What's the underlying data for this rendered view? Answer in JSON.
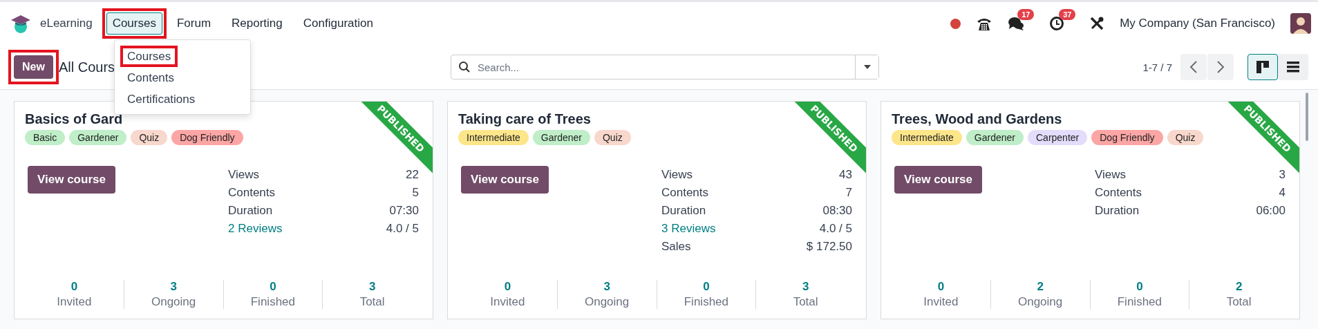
{
  "navbar": {
    "app_name": "eLearning",
    "menus": [
      {
        "label": "Courses",
        "selected": true,
        "highlighted": true
      },
      {
        "label": "Forum",
        "selected": false,
        "highlighted": false
      },
      {
        "label": "Reporting",
        "selected": false,
        "highlighted": false
      },
      {
        "label": "Configuration",
        "selected": false,
        "highlighted": false
      }
    ],
    "dropdown": [
      {
        "label": "Courses",
        "highlighted": true
      },
      {
        "label": "Contents",
        "highlighted": false
      },
      {
        "label": "Certifications",
        "highlighted": false
      }
    ],
    "messages_badge": "17",
    "activities_badge": "37",
    "company": "My Company (San Francisco)"
  },
  "control_panel": {
    "new_button": {
      "label": "New",
      "highlighted": true
    },
    "title": "All Cours",
    "search": {
      "placeholder": "Search..."
    },
    "pager": "1-7 / 7",
    "views": [
      {
        "kind": "kanban",
        "selected": true
      },
      {
        "kind": "list",
        "selected": false
      }
    ]
  },
  "cards": [
    {
      "title": "Basics of Gard",
      "ribbon": "PUBLISHED",
      "tags": [
        {
          "label": "Basic",
          "color": "#bfeec8"
        },
        {
          "label": "Gardener",
          "color": "#bfeec8"
        },
        {
          "label": "Quiz",
          "color": "#f8d7cc"
        },
        {
          "label": "Dog Friendly",
          "color": "#fca5a5"
        }
      ],
      "button": "View course",
      "stats": [
        {
          "kind": "plain",
          "label": "Views",
          "value": "22"
        },
        {
          "kind": "plain",
          "label": "Contents",
          "value": "5"
        },
        {
          "kind": "plain",
          "label": "Duration",
          "value": "07:30"
        },
        {
          "kind": "link",
          "label": "2 Reviews",
          "value": "4.0 / 5"
        }
      ],
      "counts": [
        {
          "value": "0",
          "label": "Invited"
        },
        {
          "value": "3",
          "label": "Ongoing"
        },
        {
          "value": "0",
          "label": "Finished"
        },
        {
          "value": "3",
          "label": "Total"
        }
      ]
    },
    {
      "title": "Taking care of Trees",
      "ribbon": "PUBLISHED",
      "tags": [
        {
          "label": "Intermediate",
          "color": "#fde68a"
        },
        {
          "label": "Gardener",
          "color": "#bfeec8"
        },
        {
          "label": "Quiz",
          "color": "#f8d7cc"
        }
      ],
      "button": "View course",
      "stats": [
        {
          "kind": "plain",
          "label": "Views",
          "value": "43"
        },
        {
          "kind": "plain",
          "label": "Contents",
          "value": "7"
        },
        {
          "kind": "plain",
          "label": "Duration",
          "value": "08:30"
        },
        {
          "kind": "link",
          "label": "3 Reviews",
          "value": "4.0 / 5"
        },
        {
          "kind": "plain",
          "label": "Sales",
          "value": "$ 172.50"
        }
      ],
      "counts": [
        {
          "value": "0",
          "label": "Invited"
        },
        {
          "value": "3",
          "label": "Ongoing"
        },
        {
          "value": "0",
          "label": "Finished"
        },
        {
          "value": "3",
          "label": "Total"
        }
      ]
    },
    {
      "title": "Trees, Wood and Gardens",
      "ribbon": "PUBLISHED",
      "tags": [
        {
          "label": "Intermediate",
          "color": "#fde68a"
        },
        {
          "label": "Gardener",
          "color": "#bfeec8"
        },
        {
          "label": "Carpenter",
          "color": "#e4dcfb"
        },
        {
          "label": "Dog Friendly",
          "color": "#fca5a5"
        },
        {
          "label": "Quiz",
          "color": "#f8d7cc"
        }
      ],
      "button": "View course",
      "stats": [
        {
          "kind": "plain",
          "label": "Views",
          "value": "3"
        },
        {
          "kind": "plain",
          "label": "Contents",
          "value": "4"
        },
        {
          "kind": "plain",
          "label": "Duration",
          "value": "06:00"
        }
      ],
      "counts": [
        {
          "value": "0",
          "label": "Invited"
        },
        {
          "value": "2",
          "label": "Ongoing"
        },
        {
          "value": "0",
          "label": "Finished"
        },
        {
          "value": "2",
          "label": "Total"
        }
      ]
    }
  ]
}
